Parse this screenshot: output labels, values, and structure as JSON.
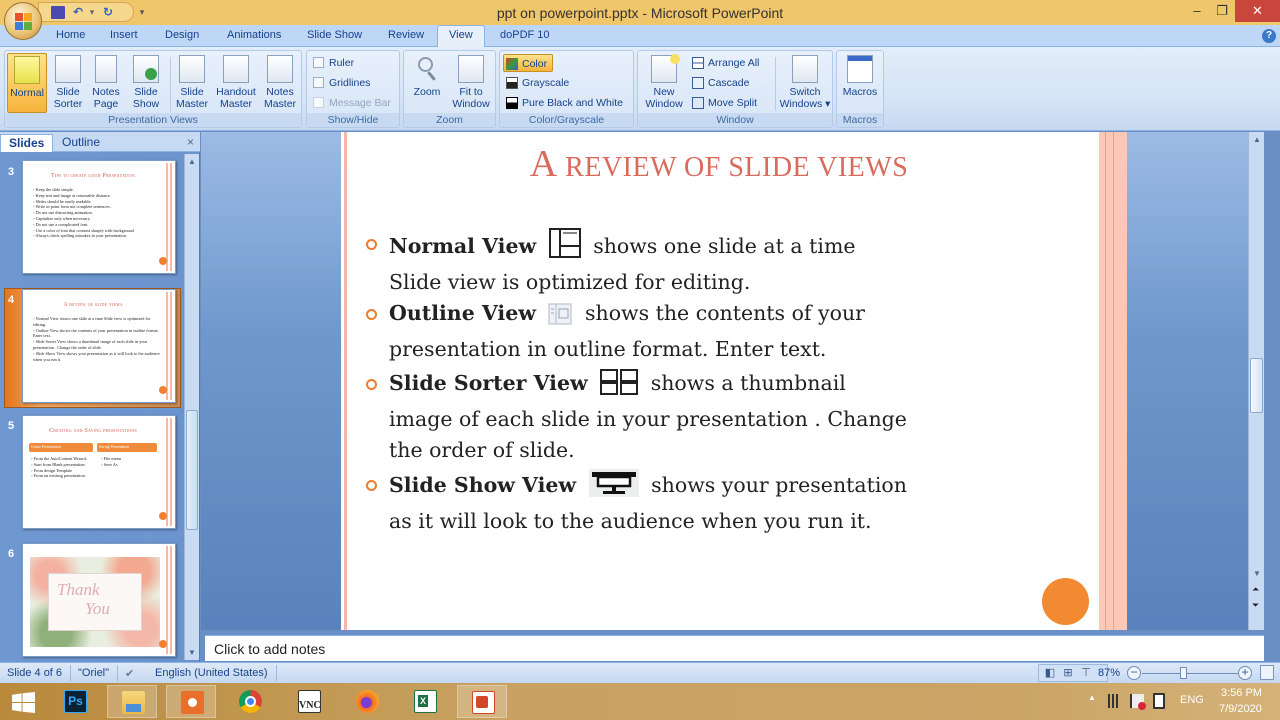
{
  "window": {
    "title": "ppt on powerpoint.pptx - Microsoft PowerPoint",
    "minimize": "–",
    "restore": "❐",
    "close": "✕"
  },
  "qat": {
    "save": "save",
    "undo": "↶",
    "undo_dropdown": "▾",
    "redo": "↻",
    "customize": "▾"
  },
  "tabs": [
    "Home",
    "Insert",
    "Design",
    "Animations",
    "Slide Show",
    "Review",
    "View",
    "doPDF 10"
  ],
  "active_tab": "View",
  "help": "?",
  "ribbon": {
    "groups": {
      "presentation_views": {
        "label": "Presentation Views",
        "buttons": [
          {
            "label1": "Normal",
            "label2": "",
            "selected": true
          },
          {
            "label1": "Slide",
            "label2": "Sorter"
          },
          {
            "label1": "Notes",
            "label2": "Page"
          },
          {
            "label1": "Slide",
            "label2": "Show"
          },
          {
            "label1": "Slide",
            "label2": "Master"
          },
          {
            "label1": "Handout",
            "label2": "Master"
          },
          {
            "label1": "Notes",
            "label2": "Master"
          }
        ]
      },
      "show_hide": {
        "label": "Show/Hide",
        "items": [
          {
            "label": "Ruler",
            "checked": false,
            "enabled": true
          },
          {
            "label": "Gridlines",
            "checked": false,
            "enabled": true
          },
          {
            "label": "Message Bar",
            "checked": false,
            "enabled": false
          }
        ]
      },
      "zoom": {
        "label": "Zoom",
        "buttons": [
          {
            "label1": "Zoom",
            "label2": ""
          },
          {
            "label1": "Fit to",
            "label2": "Window"
          }
        ]
      },
      "color_grayscale": {
        "label": "Color/Grayscale",
        "items": [
          {
            "label": "Color",
            "selected": true
          },
          {
            "label": "Grayscale"
          },
          {
            "label": "Pure Black and White"
          }
        ]
      },
      "window": {
        "label": "Window",
        "new_window": {
          "label1": "New",
          "label2": "Window"
        },
        "items": [
          {
            "label": "Arrange All"
          },
          {
            "label": "Cascade"
          },
          {
            "label": "Move Split"
          }
        ],
        "switch_windows": {
          "label1": "Switch",
          "label2": "Windows ▾"
        }
      },
      "macros": {
        "label": "Macros",
        "button": {
          "label1": "Macros"
        }
      }
    }
  },
  "left_pane": {
    "tabs": [
      "Slides",
      "Outline"
    ],
    "active_tab": "Slides",
    "close": "×",
    "thumbnails": [
      {
        "number": "3",
        "title": "Tips to create good Presentation",
        "lines": [
          "Keep the slide simple.",
          "Keep text and image at reasonable distance.",
          "Slides should be easily readable.",
          "Write in point form not complete sentences.",
          "Do not use distracting animation.",
          "Capitalize only when necessary.",
          "Do not use a complicated font.",
          "Use a color of font that contrast sharply with background",
          "Always check spelling mistakes in your presentation."
        ]
      },
      {
        "number": "4",
        "title": "A review of slide views",
        "lines": [
          "Normal View shows one slide at a time Slide view is optimized for editing.",
          "Outline View shows the contents of your presentation in outline format. Enter text.",
          "Slide Sorter View shows a thumbnail image of each slide in your presentation . Change the order of slide.",
          "Slide Show View shows your presentation as it will look to the audience when you run it."
        ],
        "selected": true
      },
      {
        "number": "5",
        "title": "Creating and Saving presentations",
        "col_left_header": "Create Presentation",
        "col_right_header": "Saving Presentation",
        "col_left_lines": [
          "From the AutoContent Wizard.",
          "Start from Blank presentation.",
          "From design Template",
          "From an existing presentation."
        ],
        "col_right_lines": [
          "File menu",
          "Save As"
        ]
      },
      {
        "number": "6",
        "title": "Thank You",
        "line1": "Thank",
        "line2": "You"
      }
    ]
  },
  "slide": {
    "title_first": "A",
    "title_rest": " REVIEW OF SLIDE VIEWS",
    "bullets": [
      {
        "bold": "Normal View",
        "icon": "normal-view-icon",
        "text": " shows one slide at a time",
        "text2": "Slide view is optimized for editing."
      },
      {
        "bold": "Outline View",
        "icon": "outline-view-icon",
        "text": " shows the contents of your",
        "text2": "presentation in outline format. Enter text."
      },
      {
        "bold": "Slide Sorter View",
        "icon": "slide-sorter-view-icon",
        "text": " shows a thumbnail",
        "text2": "image of each slide in your presentation . Change",
        "text3": "the order of slide."
      },
      {
        "bold": "Slide Show View",
        "icon": "slide-show-view-icon",
        "text": " shows your presentation",
        "text2": "as it will look to the audience when you run it."
      }
    ],
    "accent_color": "#d96b5c",
    "bullet_color": "#ef7b2b"
  },
  "notes": {
    "placeholder": "Click to add notes"
  },
  "statusbar": {
    "slide_indicator": "Slide 4 of 6",
    "theme": "\"Oriel\"",
    "language": "English (United States)",
    "zoom": "87%",
    "zoom_fraction": 0.4,
    "zoom_out": "−",
    "zoom_in": "+"
  },
  "taskbar": {
    "apps": [
      "Start",
      "Photoshop",
      "File Explorer",
      "Screen Recorder",
      "Chrome",
      "VNC Viewer",
      "Firefox",
      "Excel",
      "PowerPoint"
    ],
    "active_app": "PowerPoint",
    "tray": {
      "language": "ENG",
      "time": "3:56 PM",
      "date": "7/9/2020",
      "show_hidden": "▲"
    }
  }
}
